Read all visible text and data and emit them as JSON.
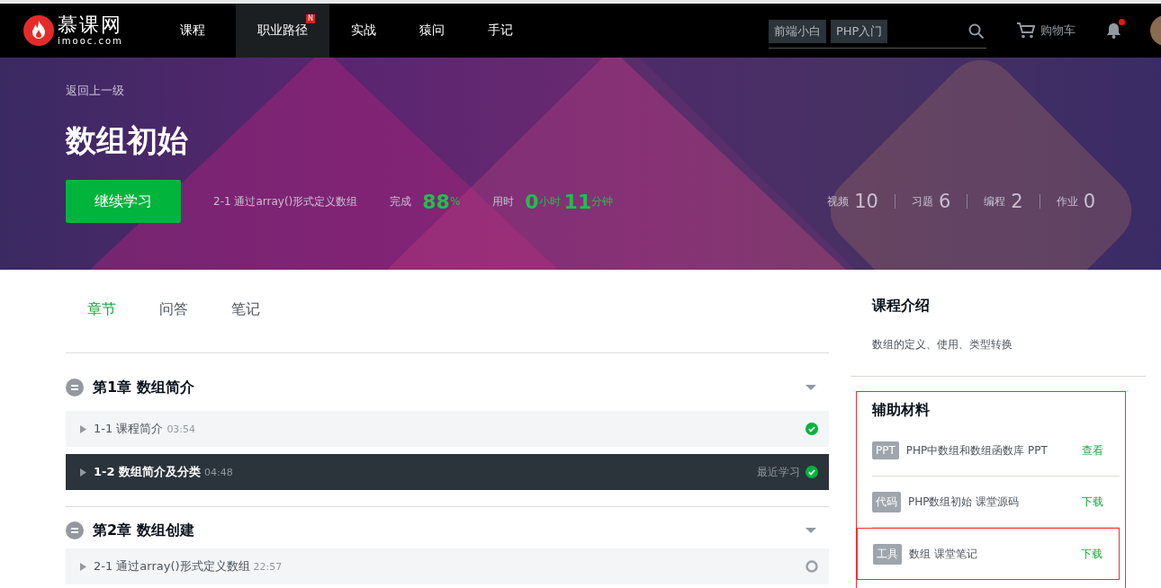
{
  "nav": {
    "logo": "慕课网",
    "logo_sub": "imooc.com",
    "items": [
      {
        "label": "课程",
        "selected": false
      },
      {
        "label": "职业路径",
        "selected": true,
        "badge": "N"
      },
      {
        "label": "实战",
        "selected": false
      },
      {
        "label": "猿问",
        "selected": false
      },
      {
        "label": "手记",
        "selected": false
      }
    ],
    "search_tags": [
      "前端小白",
      "PHP入门"
    ],
    "cart": "购物车",
    "notification": true
  },
  "banner": {
    "back": "返回上一级",
    "title": "数组初始",
    "continue_button": "继续学习",
    "current_lesson": "2-1 通过array()形式定义数组",
    "progress_label": "完成",
    "progress_value": "88",
    "progress_unit": "%",
    "time_label": "用时",
    "hours": "0",
    "hours_unit": "小时",
    "minutes": "11",
    "minutes_unit": "分钟",
    "stats": [
      {
        "label": "视频",
        "value": "10"
      },
      {
        "label": "习题",
        "value": "6"
      },
      {
        "label": "编程",
        "value": "2"
      },
      {
        "label": "作业",
        "value": "0"
      }
    ]
  },
  "tabs": [
    {
      "label": "章节",
      "selected": true
    },
    {
      "label": "问答",
      "selected": false
    },
    {
      "label": "笔记",
      "selected": false
    }
  ],
  "chapters": [
    {
      "title": "第1章 数组简介",
      "expanded": true,
      "lessons": [
        {
          "title": "1-1 课程简介",
          "duration": "03:54",
          "selected": false,
          "done": true
        },
        {
          "title": "1-2 数组简介及分类",
          "duration": "04:48",
          "selected": true,
          "done": true,
          "note": "最近学习"
        }
      ]
    },
    {
      "title": "第2章 数组创建",
      "expanded": true,
      "lessons": [
        {
          "title": "2-1 通过array()形式定义数组",
          "duration": "22:57",
          "selected": false,
          "done": false
        }
      ]
    }
  ],
  "intro": {
    "title": "课程介绍",
    "text": "数组的定义、使用、类型转换"
  },
  "materials": {
    "title": "辅助材料",
    "outlined": true,
    "items": [
      {
        "tag": "PPT",
        "name": "PHP中数组和数组函数库 PPT",
        "action": "查看",
        "outlined": false
      },
      {
        "tag": "代码",
        "name": "PHP数组初始 课堂源码",
        "action": "下载",
        "outlined": false
      },
      {
        "tag": "工具",
        "name": "数组 课堂笔记",
        "action": "下载",
        "outlined": true
      }
    ]
  }
}
